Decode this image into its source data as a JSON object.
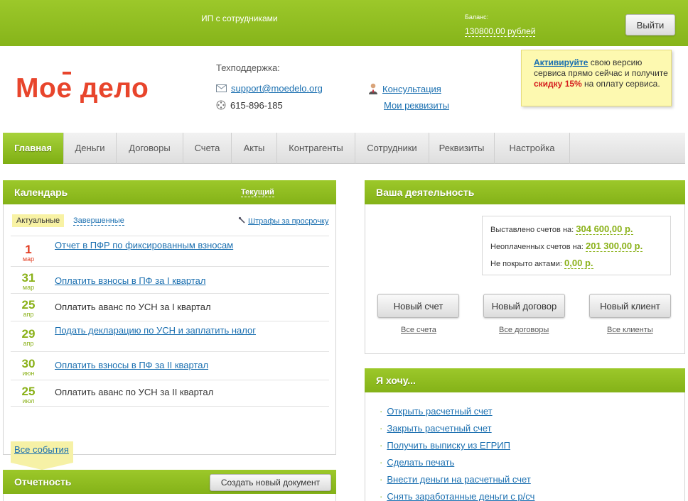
{
  "topbar": {
    "plan": "ИП с сотрудниками",
    "balance_label": "Баланс:",
    "balance_value": "130800,00 рублей",
    "exit_label": "Выйти"
  },
  "header": {
    "logo": {
      "part1": "Мо",
      "part2": "е",
      "part3": " дело"
    },
    "support_title": "Техподдержка:",
    "support_email": "support@moedelo.org",
    "support_phone": "615-896-185",
    "consult": "Консультация",
    "requisites": "Мои реквизиты",
    "promo": {
      "activate": "Активируйте",
      "text1": " свою версию сервиса прямо сейчас и получите ",
      "discount": "скидку 15%",
      "text2": " на оплату сервиса."
    }
  },
  "nav": {
    "tabs": [
      "Главная",
      "Деньги",
      "Договоры",
      "Счета",
      "Акты",
      "Контрагенты",
      "Сотрудники",
      "Реквизиты",
      "Настройка"
    ]
  },
  "calendar": {
    "title": "Календарь",
    "current": "Текущий",
    "tab_active": "Актуальные",
    "tab_done": "Завершенные",
    "fines": "Штрафы за просрочку",
    "events": [
      {
        "day": "1",
        "month": "мар",
        "text": "Отчет в ПФР по фиксированным взносам",
        "link": true,
        "red": true
      },
      {
        "day": "31",
        "month": "мар",
        "text": "Оплатить взносы в ПФ за I квартал",
        "link": true,
        "red": false
      },
      {
        "day": "25",
        "month": "апр",
        "text": "Оплатить аванс по УСН за I квартал",
        "link": false,
        "red": false
      },
      {
        "day": "29",
        "month": "апр",
        "text": "Подать декларацию по УСН и заплатить налог",
        "link": true,
        "red": false
      },
      {
        "day": "30",
        "month": "июн",
        "text": "Оплатить взносы в ПФ за II квартал",
        "link": true,
        "red": false
      },
      {
        "day": "25",
        "month": "июл",
        "text": "Оплатить аванс по УСН за II квартал",
        "link": false,
        "red": false
      }
    ],
    "all_events": "Все события"
  },
  "activity": {
    "title": "Ваша деятельность",
    "stats": [
      {
        "label": "Выставлено счетов на:",
        "value": "304 600,00 р."
      },
      {
        "label": "Неоплаченных счетов на:",
        "value": "201 300,00 р."
      },
      {
        "label": "Не покрыто актами:",
        "value": "0,00 р."
      }
    ],
    "buttons": [
      "Новый счет",
      "Новый договор",
      "Новый клиент"
    ],
    "links": [
      "Все счета",
      "Все договоры",
      "Все клиенты"
    ]
  },
  "want": {
    "title": "Я хочу...",
    "items": [
      "Открыть расчетный счет",
      "Закрыть расчетный счет",
      "Получить выписку из ЕГРИП",
      "Сделать печать",
      "Внести деньги на расчетный счет",
      "Снять заработанные деньги с р/сч"
    ]
  },
  "reporting": {
    "title": "Отчетность",
    "create": "Создать новый документ"
  }
}
